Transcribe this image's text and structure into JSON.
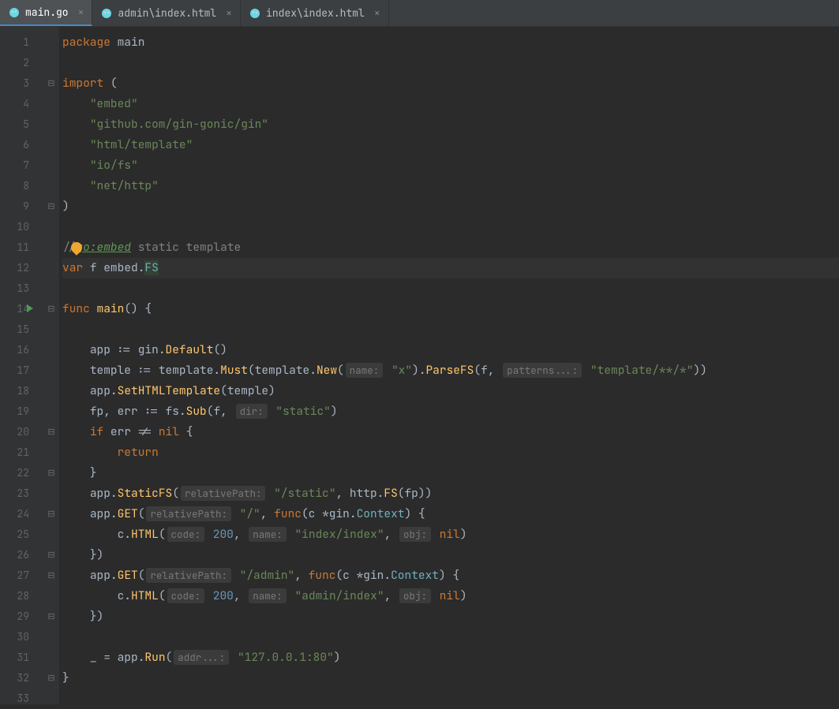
{
  "tabs": [
    {
      "label": "main.go",
      "active": true,
      "closable": true
    },
    {
      "label": "admin\\index.html",
      "active": false,
      "closable": true
    },
    {
      "label": "index\\index.html",
      "active": false,
      "closable": true
    }
  ],
  "gutter": {
    "start": 1,
    "end": 33,
    "runMarkerAt": 14
  },
  "code": {
    "l1": {
      "pkg": "package",
      "name": "main"
    },
    "l3": {
      "imp": "import",
      "paren": "("
    },
    "l4": "\"embed\"",
    "l5": "\"github.com/gin-gonic/gin\"",
    "l6": "\"html/template\"",
    "l7": "\"io/fs\"",
    "l8": "\"net/http\"",
    "l9": ")",
    "l11": {
      "slashes": "//",
      "directive": "go:embed",
      "rest": " static template"
    },
    "l12": {
      "var": "var",
      "name": "f",
      "pkg": "embed",
      "type": "FS"
    },
    "l14": {
      "func": "func",
      "name": "main",
      "rest": "() {"
    },
    "l16": {
      "a": "app ",
      "op": ":=",
      "b": " gin.",
      "fn": "Default",
      "c": "()"
    },
    "l17": {
      "a": "temple ",
      "op": ":=",
      "b": " template.",
      "fn1": "Must",
      "c": "(template.",
      "fn2": "New",
      "d": "(",
      "hint1": "name:",
      "str1": "\"x\"",
      "e": ").",
      "fn3": "ParseFS",
      "f": "(f, ",
      "hint2": "patterns...:",
      "str2": "\"template/**/*\"",
      "g": "))"
    },
    "l18": {
      "a": "app.",
      "fn": "SetHTMLTemplate",
      "b": "(temple)"
    },
    "l19": {
      "a": "fp, err ",
      "op": ":=",
      "b": " fs.",
      "fn": "Sub",
      "c": "(f, ",
      "hint": "dir:",
      "str": "\"static\"",
      "d": ")"
    },
    "l20": {
      "if": "if",
      "a": " err != ",
      "nil": "nil",
      "b": " {"
    },
    "l21": "return",
    "l22": "}",
    "l23": {
      "a": "app.",
      "fn": "StaticFS",
      "b": "(",
      "hint": "relativePath:",
      "str": "\"/static\"",
      "c": ", http.",
      "fn2": "FS",
      "d": "(fp))"
    },
    "l24": {
      "a": "app.",
      "fn": "GET",
      "b": "(",
      "hint": "relativePath:",
      "str": "\"/\"",
      "c": ", ",
      "func": "func",
      "d": "(c *gin.",
      "type": "Context",
      "e": ") {"
    },
    "l25": {
      "a": "c.",
      "fn": "HTML",
      "b": "(",
      "hint1": "code:",
      "num": "200",
      "c": ", ",
      "hint2": "name:",
      "str": "\"index/index\"",
      "d": ", ",
      "hint3": "obj:",
      "nil": "nil",
      "e": ")"
    },
    "l26": "})",
    "l27": {
      "a": "app.",
      "fn": "GET",
      "b": "(",
      "hint": "relativePath:",
      "str": "\"/admin\"",
      "c": ", ",
      "func": "func",
      "d": "(c *gin.",
      "type": "Context",
      "e": ") {"
    },
    "l28": {
      "a": "c.",
      "fn": "HTML",
      "b": "(",
      "hint1": "code:",
      "num": "200",
      "c": ", ",
      "hint2": "name:",
      "str": "\"admin/index\"",
      "d": ", ",
      "hint3": "obj:",
      "nil": "nil",
      "e": ")"
    },
    "l29": "})",
    "l31": {
      "a": "_ = app.",
      "fn": "Run",
      "b": "(",
      "hint": "addr...:",
      "str": "\"127.0.0.1:80\"",
      "c": ")"
    },
    "l32": "}"
  }
}
